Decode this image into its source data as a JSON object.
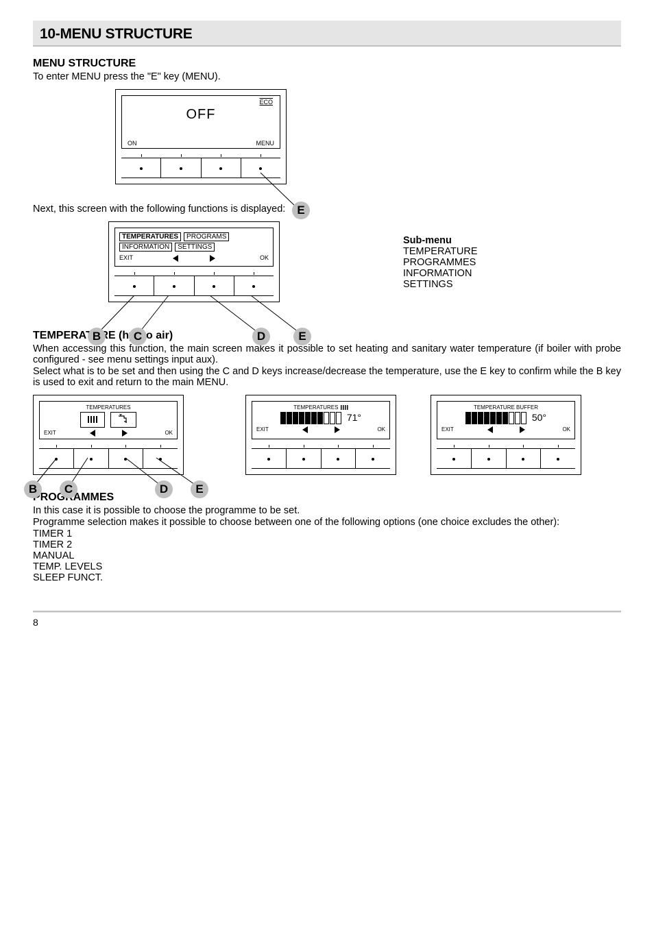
{
  "chapter_title": "10-MENU STRUCTURE",
  "menu_structure": {
    "heading": "MENU STRUCTURE",
    "intro": "To enter MENU press the \"E\" key (MENU).",
    "screen1": {
      "big": "OFF",
      "eco": "ECO",
      "on": "ON",
      "menu": "MENU"
    },
    "next_line": "Next, this screen with the following functions is displayed:",
    "screen2": {
      "temperatures": "TEMPERATURES",
      "programs": "PROGRAMS",
      "information": "INFORMATION",
      "settings": "SETTINGS",
      "exit": "EXIT",
      "ok": "OK"
    },
    "submenu": {
      "title": "Sub-menu",
      "items": [
        "TEMPERATURE",
        "PROGRAMMES",
        "INFORMATION",
        "SETTINGS"
      ]
    }
  },
  "temperature": {
    "heading": "TEMPERATURE (hydro air)",
    "p1": "When accessing this function, the main screen makes it possible to set heating and sanitary water temperature (if boiler with probe configured - see menu settings input aux).",
    "p2": "Select what is to be set and then using the C and D keys increase/decrease the temperature, use the E key to confirm while the B key is used to exit and return to the main MENU.",
    "screenA": {
      "title": "TEMPERATURES",
      "exit": "EXIT",
      "ok": "OK"
    },
    "screenB": {
      "title": "TEMPERATURES",
      "value": "71°",
      "exit": "EXIT",
      "ok": "OK"
    },
    "screenC": {
      "title": "TEMPERATURE BUFFER",
      "value": "50°",
      "exit": "EXIT",
      "ok": "OK"
    }
  },
  "programmes": {
    "heading": "PROGRAMMES",
    "p1": "In this case it is possible to choose the programme to be set.",
    "p2": "Programme selection makes it possible to choose between one of the following options (one choice excludes the other):",
    "list": [
      "TIMER 1",
      "TIMER 2",
      "MANUAL",
      "TEMP. LEVELS",
      "SLEEP FUNCT."
    ]
  },
  "markers": {
    "B": "B",
    "C": "C",
    "D": "D",
    "E": "E"
  },
  "page_number": "8"
}
